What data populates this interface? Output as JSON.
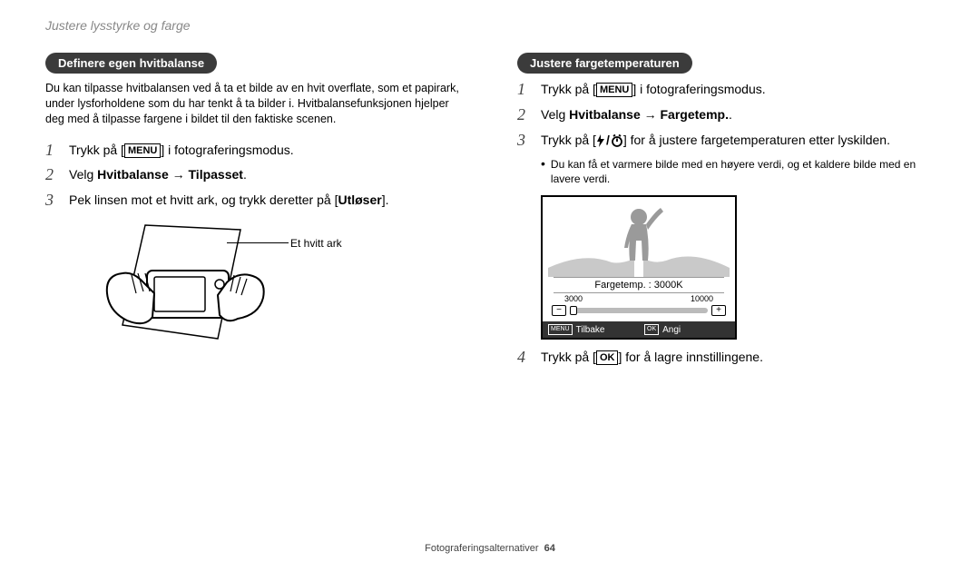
{
  "header": "Justere lysstyrke og farge",
  "left": {
    "pill": "Definere egen hvitbalanse",
    "intro": "Du kan tilpasse hvitbalansen ved å ta et bilde av en hvit overflate, som et papirark, under lysforholdene som du har tenkt å ta bilder i. Hvitbalansefunksjonen hjelper deg med å tilpasse fargene i bildet til den faktiske scenen.",
    "step1_a": "Trykk på [",
    "step1_menu": "MENU",
    "step1_b": "] i fotograferingsmodus.",
    "step2_a": "Velg ",
    "step2_b": "Hvitbalanse → Tilpasset",
    "step2_c": ".",
    "step3_a": "Pek linsen mot et hvitt ark, og trykk deretter på [",
    "step3_b": "Utløser",
    "step3_c": "].",
    "illus_label": "Et hvitt ark"
  },
  "right": {
    "pill": "Justere fargetemperaturen",
    "step1_a": "Trykk på [",
    "step1_menu": "MENU",
    "step1_b": "] i fotograferingsmodus.",
    "step2_a": "Velg ",
    "step2_b": "Hvitbalanse → Fargetemp.",
    "step2_c": ".",
    "step3_a": "Trykk på [",
    "step3_b": "] for å justere fargetemperaturen etter lyskilden.",
    "bullet": "Du kan få et varmere bilde med en høyere verdi, og et kaldere bilde med en lavere verdi.",
    "screen": {
      "label": "Fargetemp. : 3000K",
      "scale_left": "3000",
      "scale_right": "10000",
      "minus": "−",
      "plus": "+",
      "back_box": "MENU",
      "back": "Tilbake",
      "set_box": "OK",
      "set": "Angi"
    },
    "step4_a": "Trykk på [",
    "step4_ok": "OK",
    "step4_b": "] for å lagre innstillingene."
  },
  "footer": {
    "section": "Fotograferingsalternativer",
    "page": "64"
  }
}
